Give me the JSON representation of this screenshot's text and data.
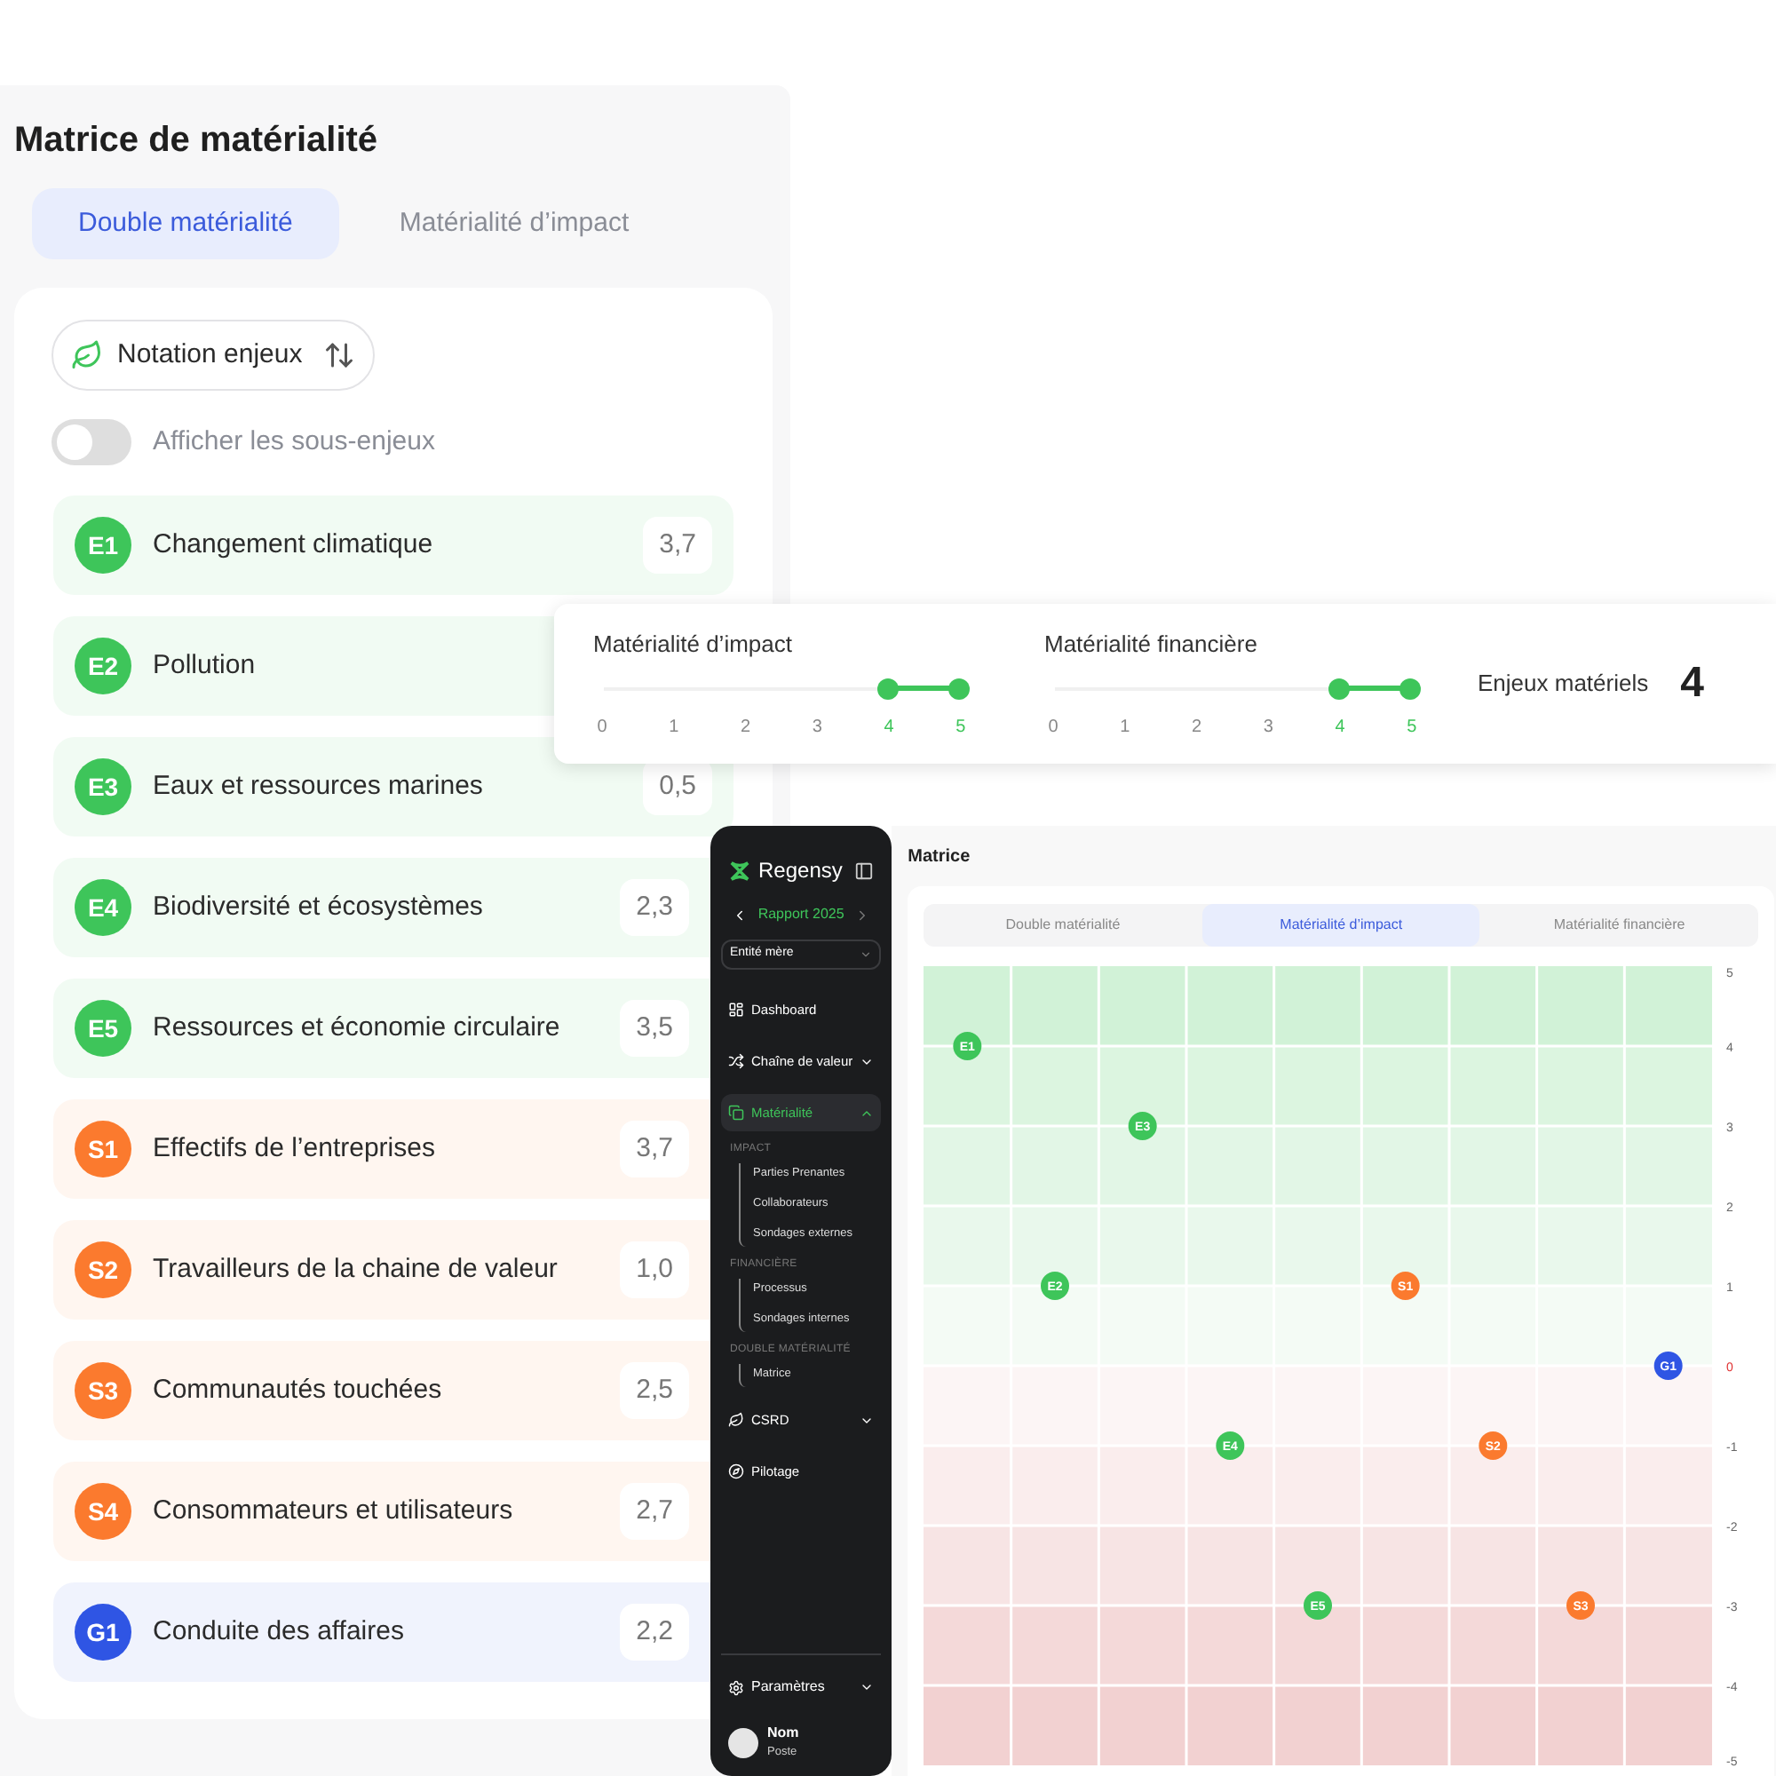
{
  "left_panel": {
    "title": "Matrice de matérialité",
    "tabs": [
      {
        "label": "Double matérialité",
        "selected": true
      },
      {
        "label": "Matérialité d’impact",
        "selected": false
      }
    ],
    "sort_button": {
      "label": "Notation enjeux"
    },
    "toggle": {
      "label": "Afficher les sous-enjeux",
      "on": false
    },
    "issues": [
      {
        "code": "E1",
        "label": "Changement climatique",
        "value": "3,7",
        "color": "#3ec55a"
      },
      {
        "code": "E2",
        "label": "Pollution",
        "color": "#3ec55a"
      },
      {
        "code": "E3",
        "label": "Eaux et ressources marines",
        "value": "0,5",
        "color": "#3ec55a"
      },
      {
        "code": "E4",
        "label": "Biodiversité et écosystèmes",
        "value": "2,3",
        "color": "#3ec55a"
      },
      {
        "code": "E5",
        "label": "Ressources et économie circulaire",
        "value": "3,5",
        "color": "#3ec55a"
      },
      {
        "code": "S1",
        "label": "Effectifs de l’entreprises",
        "value": "3,7",
        "color": "#fb7a2e"
      },
      {
        "code": "S2",
        "label": "Travailleurs de la chaine de valeur",
        "value": "1,0",
        "color": "#fb7a2e"
      },
      {
        "code": "S3",
        "label": "Communautés touchées",
        "value": "2,5",
        "color": "#fb7a2e"
      },
      {
        "code": "S4",
        "label": "Consommateurs et utilisateurs",
        "value": "2,7",
        "color": "#fb7a2e"
      },
      {
        "code": "G1",
        "label": "Conduite des affaires",
        "value": "2,2",
        "color": "#2f55e4"
      }
    ]
  },
  "filter_card": {
    "sliders": [
      {
        "label": "Matérialité d’impact",
        "ticks": [
          {
            "label": "0",
            "selected": false
          },
          {
            "label": "1",
            "selected": false
          },
          {
            "label": "2",
            "selected": false
          },
          {
            "label": "3",
            "selected": false
          },
          {
            "label": "4",
            "selected": true
          },
          {
            "label": "5",
            "selected": true
          }
        ]
      },
      {
        "label": "Matérialité financière",
        "ticks": [
          {
            "label": "0",
            "selected": false
          },
          {
            "label": "1",
            "selected": false
          },
          {
            "label": "2",
            "selected": false
          },
          {
            "label": "3",
            "selected": false
          },
          {
            "label": "4",
            "selected": true
          },
          {
            "label": "5",
            "selected": true
          }
        ]
      }
    ],
    "count_label": "Enjeux matériels",
    "count": "4"
  },
  "app": {
    "sidebar": {
      "brand": "Regensy",
      "report": "Rapport 2025",
      "entity": "Entité mère",
      "nav": [
        {
          "kind": "link",
          "label": "Dashboard",
          "selected": false
        },
        {
          "kind": "menu",
          "label": "Chaîne de valeur",
          "selected": false,
          "expanded": false
        },
        {
          "kind": "menu",
          "label": "Matérialité",
          "selected": true,
          "expanded": true,
          "groups": [
            {
              "heading": "IMPACT",
              "children": [
                "Parties Prenantes",
                "Collaborateurs",
                "Sondages externes"
              ]
            },
            {
              "heading": "FINANCIÈRE",
              "children": [
                "Processus",
                "Sondages internes"
              ]
            },
            {
              "heading": "DOUBLE MATÉRIALITÉ",
              "children": [
                "Matrice"
              ]
            }
          ]
        },
        {
          "kind": "menu",
          "label": "CSRD",
          "selected": false,
          "expanded": false
        },
        {
          "kind": "link",
          "label": "Pilotage",
          "selected": false
        }
      ],
      "settings": {
        "label": "Paramètres",
        "expanded": false
      },
      "user": {
        "name": "Nom",
        "role": "Poste"
      }
    },
    "page_title": "Matrice",
    "tabs": [
      {
        "label": "Double matérialité",
        "selected": false
      },
      {
        "label": "Matérialité d’impact",
        "selected": true
      },
      {
        "label": "Matérialité financière",
        "selected": false
      }
    ],
    "chart_data": {
      "type": "scatter",
      "categories": [
        "E1",
        "E2",
        "E3",
        "E4",
        "E5",
        "S1",
        "S2",
        "S3",
        "G1"
      ],
      "series": [
        {
          "color": "#3ec55a",
          "values": [
            4,
            1,
            3,
            -1,
            -3,
            null,
            null,
            null,
            null
          ]
        },
        {
          "color": "#fb7a2e",
          "values": [
            null,
            null,
            null,
            null,
            null,
            1,
            -1,
            -3,
            null
          ]
        },
        {
          "color": "#2f55e4",
          "values": [
            null,
            null,
            null,
            null,
            null,
            null,
            null,
            null,
            0
          ]
        }
      ],
      "grid": true,
      "ylim": [
        -5,
        5
      ],
      "yticks": [
        5,
        4,
        3,
        2,
        1,
        0,
        -1,
        -2,
        -3,
        -4,
        -5
      ]
    }
  }
}
